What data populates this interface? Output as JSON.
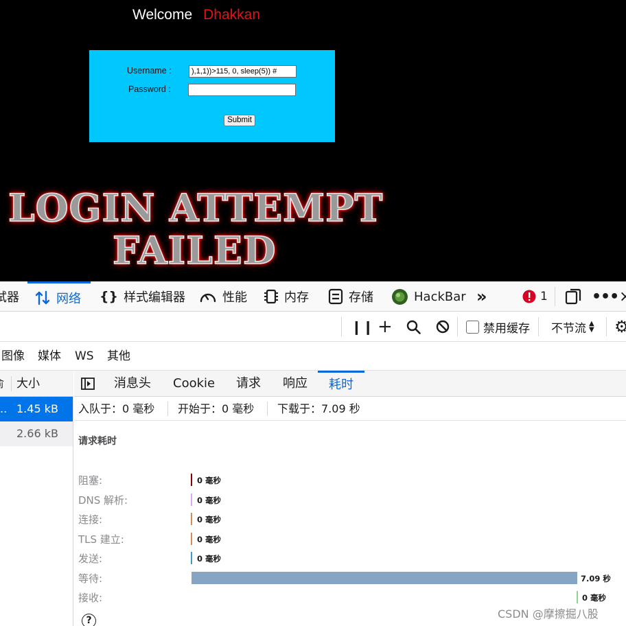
{
  "page": {
    "welcome": "Welcome",
    "user": "Dhakkan",
    "username_label": "Username :",
    "password_label": "Password :",
    "username_value": "),1,1))>115, 0, sleep(5)) #",
    "password_value": "",
    "submit_label": "Submit",
    "fail_line1": "LOGIN ATTEMPT",
    "fail_line2": "FAILED",
    "colors": {
      "background": "#000000",
      "form_bg": "#00c8ff",
      "user": "#e0131a"
    }
  },
  "devtools": {
    "tabs": [
      {
        "label": "试器",
        "icon": "debugger-icon"
      },
      {
        "label": "网络",
        "icon": "network-icon",
        "active": true
      },
      {
        "label": "样式编辑器",
        "icon": "braces-icon"
      },
      {
        "label": "性能",
        "icon": "gauge-icon"
      },
      {
        "label": "内存",
        "icon": "memory-icon"
      },
      {
        "label": "存储",
        "icon": "storage-icon"
      },
      {
        "label": "HackBar",
        "icon": "hackbar-icon"
      }
    ],
    "error_count": "1",
    "net_toolbar": {
      "disable_cache_label": "禁用缓存",
      "throttle_label": "不节流"
    },
    "filters": [
      "图像",
      "媒体",
      "WS",
      "其他"
    ],
    "request_list": {
      "size_header": "大小",
      "rows": [
        {
          "size": "1.45 kB",
          "selected": true
        },
        {
          "size": "2.66 kB",
          "selected": false
        }
      ]
    },
    "detail_tabs": [
      "消息头",
      "Cookie",
      "请求",
      "响应",
      "耗时"
    ],
    "active_detail_tab": "耗时",
    "summary": {
      "queued": "入队于：0 毫秒",
      "started": "开始于：0 毫秒",
      "downloaded": "下载于：7.09 秒"
    },
    "timing_title": "请求耗时",
    "timings": [
      {
        "label": "阻塞:",
        "value": "0 毫秒",
        "color": "#8b0000"
      },
      {
        "label": "DNS 解析:",
        "value": "0 毫秒",
        "color": "#d9a7f0"
      },
      {
        "label": "连接:",
        "value": "0 毫秒",
        "color": "#d88a5a"
      },
      {
        "label": "TLS 建立:",
        "value": "0 毫秒",
        "color": "#d88a5a"
      },
      {
        "label": "发送:",
        "value": "0 毫秒",
        "color": "#3d9bd0"
      },
      {
        "label": "等待:",
        "value": "7.09 秒",
        "color": "#86a5c4"
      },
      {
        "label": "接收:",
        "value": "0 毫秒",
        "color": "#8fd18f"
      }
    ],
    "help_glyph": "?"
  },
  "watermark": "CSDN @摩擦掘八股"
}
